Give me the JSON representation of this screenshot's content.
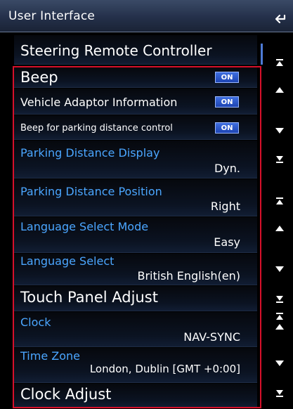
{
  "header": {
    "title": "User Interface"
  },
  "items": [
    {
      "label": "Steering Remote Controller"
    },
    {
      "label": "Beep",
      "toggle": "ON"
    },
    {
      "label": "Vehicle Adaptor Information",
      "toggle": "ON"
    },
    {
      "label": "Beep for parking distance control",
      "toggle": "ON"
    },
    {
      "label": "Parking Distance Display",
      "value": "Dyn."
    },
    {
      "label": "Parking Distance Position",
      "value": "Right"
    },
    {
      "label": "Language Select Mode",
      "value": "Easy"
    },
    {
      "label": "Language Select",
      "value": "British English(en)"
    },
    {
      "label": "Touch Panel Adjust"
    },
    {
      "label": "Clock",
      "value": "NAV-SYNC"
    },
    {
      "label": "Time Zone",
      "value": "London, Dublin [GMT +0:00]"
    },
    {
      "label": "Clock Adjust"
    }
  ],
  "scroll_buttons": [
    "page-top-icon",
    "scroll-up-icon",
    "scroll-down-icon",
    "page-bottom-icon"
  ],
  "colors": {
    "accent_blue": "#4ba6ff",
    "toggle_blue": "#2a55c8",
    "highlight_red": "#d6102a",
    "header": "#2a3650"
  }
}
